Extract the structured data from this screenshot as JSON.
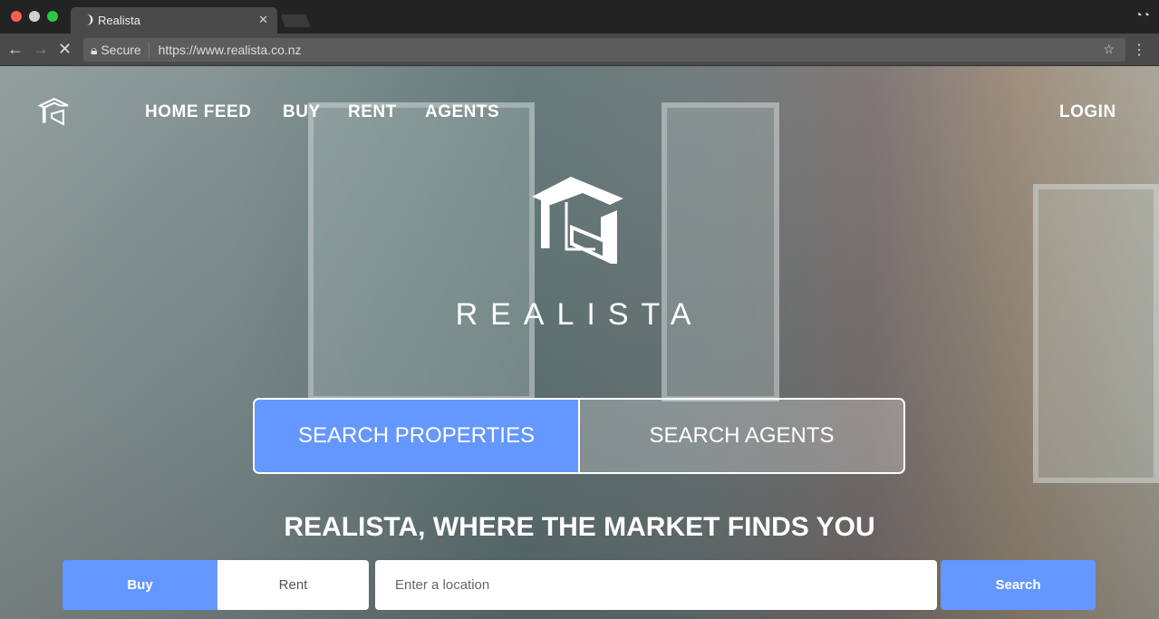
{
  "browser": {
    "tab_title": "Realista",
    "secure_label": "Secure",
    "url": "https://www.realista.co.nz"
  },
  "nav": {
    "items": [
      "HOME FEED",
      "BUY",
      "RENT",
      "AGENTS"
    ],
    "login": "LOGIN"
  },
  "brand": {
    "name": "REALISTA"
  },
  "search_tabs": {
    "properties": "SEARCH PROPERTIES",
    "agents": "SEARCH AGENTS"
  },
  "tagline": "REALISTA, WHERE THE MARKET FINDS YOU",
  "search_bar": {
    "buy": "Buy",
    "rent": "Rent",
    "location_placeholder": "Enter a location",
    "search": "Search"
  },
  "colors": {
    "accent": "#6497ff"
  }
}
